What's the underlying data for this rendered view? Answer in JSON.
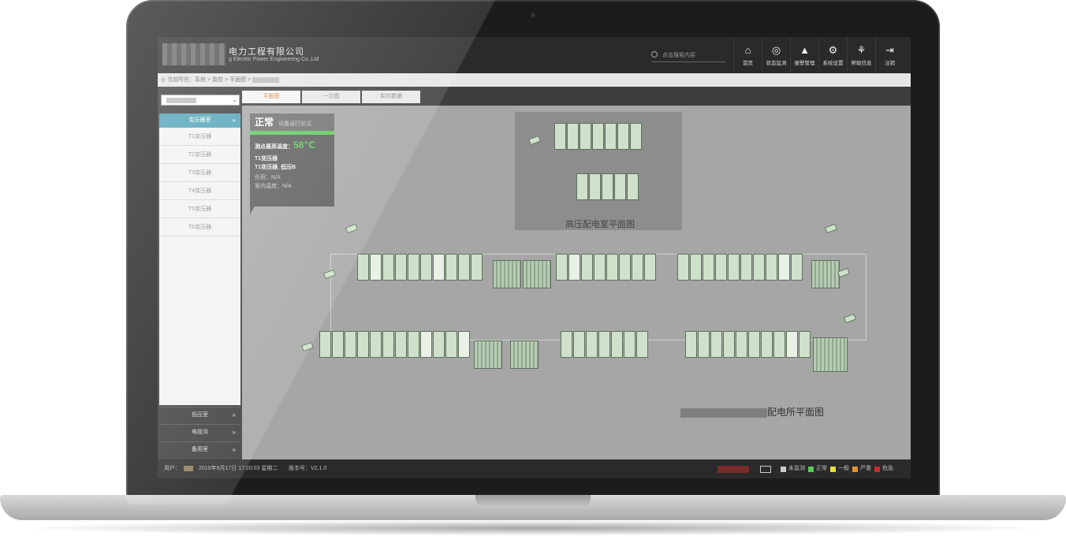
{
  "header": {
    "company_cn": "电力工程有限公司",
    "company_en": "g Electric Power Engineering Co.,Ltd",
    "search_placeholder": "点击搜索内容",
    "nav": [
      {
        "icon": "⌂",
        "label": "首页"
      },
      {
        "icon": "◎",
        "label": "状态监测"
      },
      {
        "icon": "▲",
        "label": "报警管理"
      },
      {
        "icon": "⚙",
        "label": "系统设置"
      },
      {
        "icon": "⚘",
        "label": "帮助信息"
      },
      {
        "icon": "⇥",
        "label": "注销"
      }
    ]
  },
  "breadcrumb": {
    "text": "◎ 当前所在：系统 > 监控 > 平面图 >"
  },
  "sidebar": {
    "active_group": "变压器室",
    "items": [
      "T1变压器",
      "T2变压器",
      "T3变压器",
      "T4变压器",
      "T5变压器",
      "T6变压器"
    ],
    "groups": [
      "低压室",
      "电缆沟",
      "备用室"
    ]
  },
  "tabs": [
    "平面图",
    "一次图",
    "实时数据"
  ],
  "status": {
    "state": "正常",
    "state_desc": "设备运行状况",
    "max_temp_label": "测点最高温度：",
    "max_temp_value": "58℃",
    "device_line1": "T1变压器",
    "device_line2": "T1变压器_低压B",
    "load_label": "负荷：N/A",
    "env_label": "室内温度：N/A"
  },
  "floorplan": {
    "hv_title": "高压配电室平面图",
    "main_title": "配电所平面图"
  },
  "footer": {
    "user_label": "用户：",
    "datetime": "2019年9月17日 17:20:03 星期二",
    "version": "版本号：V2.1.0",
    "legend": [
      {
        "label": "未监测",
        "color": "#cccccc"
      },
      {
        "label": "正常",
        "color": "#5cc85a"
      },
      {
        "label": "一般",
        "color": "#e8e03a"
      },
      {
        "label": "严重",
        "color": "#e8922a"
      },
      {
        "label": "危急",
        "color": "#d02a2a"
      }
    ]
  }
}
